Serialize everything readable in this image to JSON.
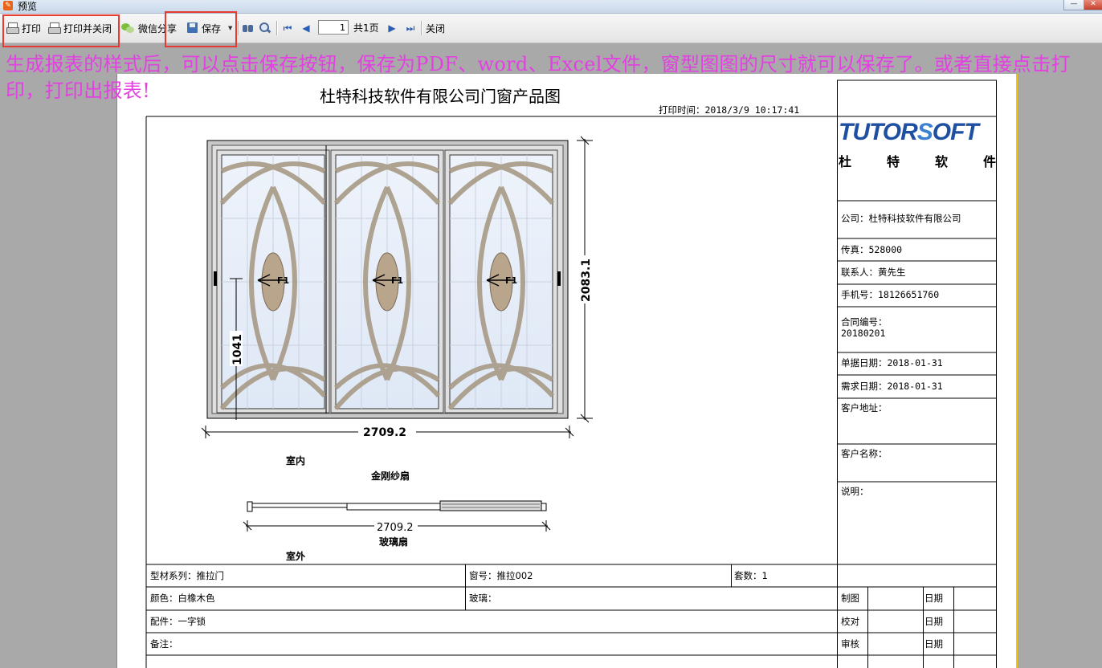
{
  "window": {
    "title": "预览"
  },
  "toolbar": {
    "print_label": "打印",
    "print_close_label": "打印并关闭",
    "wechat_label": "微信分享",
    "save_label": "保存",
    "page_value": "1",
    "page_total": "共1页",
    "close_label": "关闭"
  },
  "annotation": "生成报表的样式后，可以点击保存按钮，保存为PDF、word、Excel文件，窗型图图的尺寸就可以保存了。或者直接点击打印，打印出报表!",
  "report": {
    "title": "杜特科技软件有限公司门窗产品图",
    "print_time": "打印时间：2018/3/9 10:17:41",
    "logo": {
      "brand_left": "TUTOR",
      "brand_s": "S",
      "brand_right": "OFT",
      "chars": [
        "杜",
        "特",
        "软",
        "件"
      ]
    },
    "info": {
      "company": "公司：杜特科技软件有限公司",
      "fax": "传真：528000",
      "contact": "联系人：黄先生",
      "mobile": "手机号：18126651760",
      "contract_label": "合同编号：",
      "contract_value": "20180201",
      "doc_date": "单据日期：2018-01-31",
      "need_date": "需求日期：2018-01-31",
      "address": "客户地址：",
      "customer": "客户名称：",
      "note": "说明："
    },
    "drawing": {
      "height_dim": "2083.1",
      "handle_dim": "1041",
      "width_dim": "2709.2",
      "indoor": "室内",
      "screen_label": "金刚纱扇",
      "section_dim": "2709.2",
      "glass_label": "玻璃扇",
      "outdoor": "室外",
      "sash_marks": [
        "F1",
        "F1",
        "F1"
      ]
    },
    "rows": {
      "series": "型材系列：推拉门",
      "window_no": "窗号：推拉002",
      "sets": "套数：1",
      "color": "颜色：白橡木色",
      "glass": "玻璃：",
      "parts": "配件：一字锁",
      "remark": "备注：",
      "drafted": "制图",
      "checked": "校对",
      "reviewed": "审核",
      "date1": "日期",
      "date2": "日期",
      "date3": "日期"
    }
  }
}
